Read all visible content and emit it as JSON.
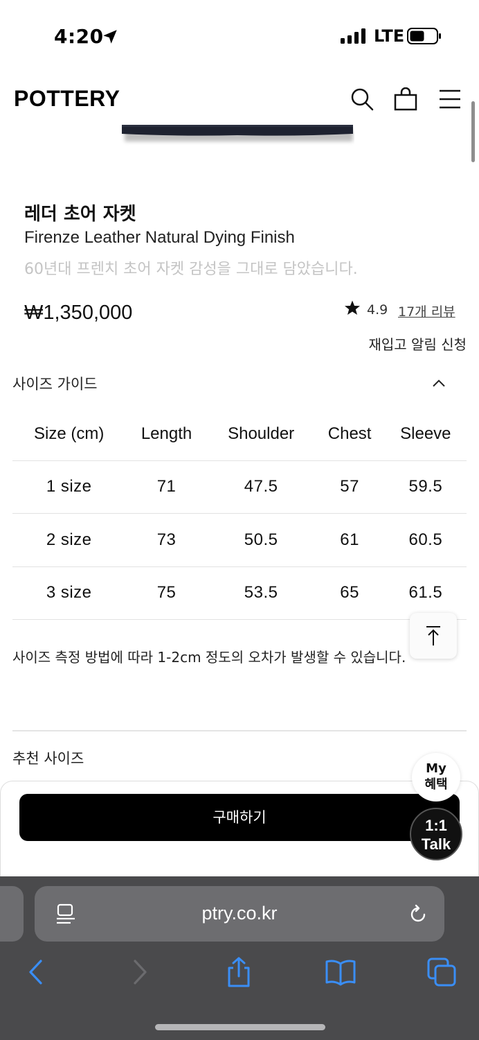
{
  "status_bar": {
    "time": "4:20",
    "network": "LTE"
  },
  "header": {
    "brand": "POTTERY",
    "icons": [
      "search-icon",
      "shopping-bag-icon",
      "hamburger-menu-icon"
    ]
  },
  "product": {
    "title": "레더 초어 자켓",
    "subtitle": "Firenze Leather Natural Dying Finish",
    "description": "60년대 프렌치 초어 자켓 감성을 그대로 담았습니다.",
    "price": "₩1,350,000",
    "rating": "4.9",
    "review_link": "17개 리뷰",
    "restock_link": "재입고 알림 신청"
  },
  "size_guide": {
    "title": "사이즈 가이드",
    "headers": [
      "Size (cm)",
      "Length",
      "Shoulder",
      "Chest",
      "Sleeve"
    ],
    "rows": [
      [
        "1 size",
        "71",
        "47.5",
        "57",
        "59.5"
      ],
      [
        "2 size",
        "73",
        "50.5",
        "61",
        "60.5"
      ],
      [
        "3 size",
        "75",
        "53.5",
        "65",
        "61.5"
      ]
    ],
    "note": "사이즈 측정 방법에 따라 1-2cm 정도의 오차가 발생할 수 있습니다."
  },
  "recommend": {
    "title": "추천 사이즈"
  },
  "purchase": {
    "buy_label": "구매하기"
  },
  "floating": {
    "my_benefit": "My\n혜택",
    "talk": "1:1\nTalk"
  },
  "browser": {
    "url": "ptry.co.kr"
  },
  "colors": {
    "accent_blue": "#3a8ef6",
    "button_black": "#000000",
    "safari_bg": "#4a4a4c"
  }
}
